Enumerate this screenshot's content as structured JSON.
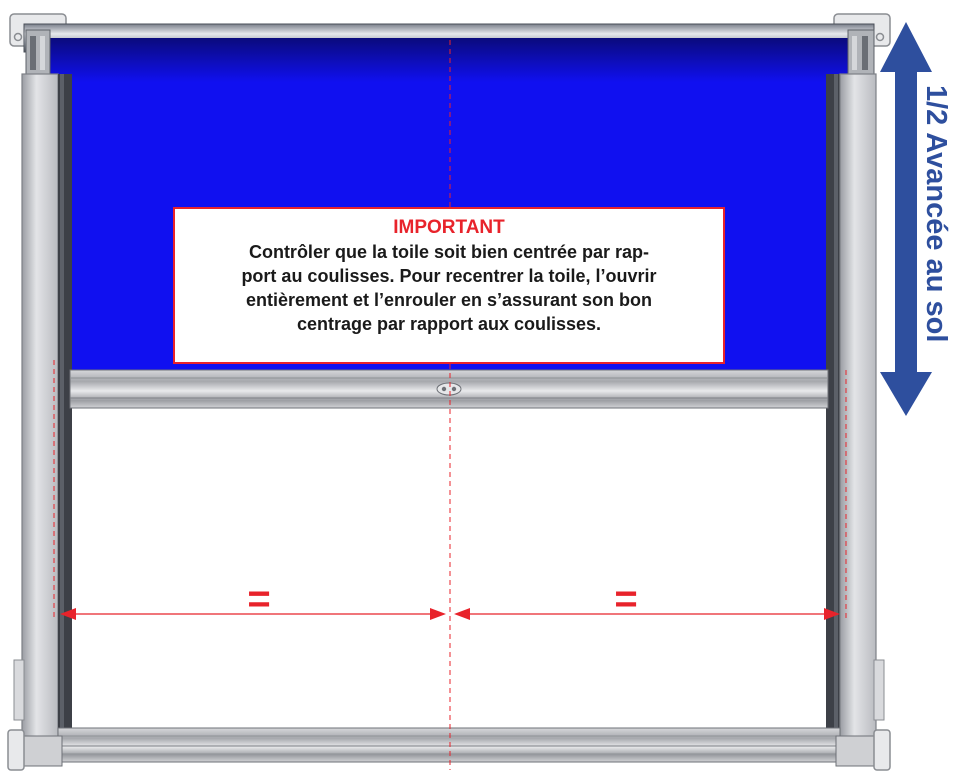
{
  "notice": {
    "title": "IMPORTANT",
    "lines": [
      "Contrôler que la toile soit bien centrée par rap-",
      "port au coulisses. Pour recentrer la toile, l’ouvrir",
      "entièrement et l’enrouler en s’assurant son bon",
      "centrage par rapport aux coulisses."
    ]
  },
  "side_label": "1/2 Avancée au sol",
  "left_equal_mark": "=",
  "right_equal_mark": "=",
  "colors": {
    "fabric_blue": "#1010f0",
    "warning_red": "#e8232b",
    "label_blue": "#2e4f9e",
    "frame_gray": "#c8c8c8"
  },
  "icons": [
    "double-arrow-vertical-icon",
    "dimension-arrow-icon",
    "centerline-icon"
  ]
}
